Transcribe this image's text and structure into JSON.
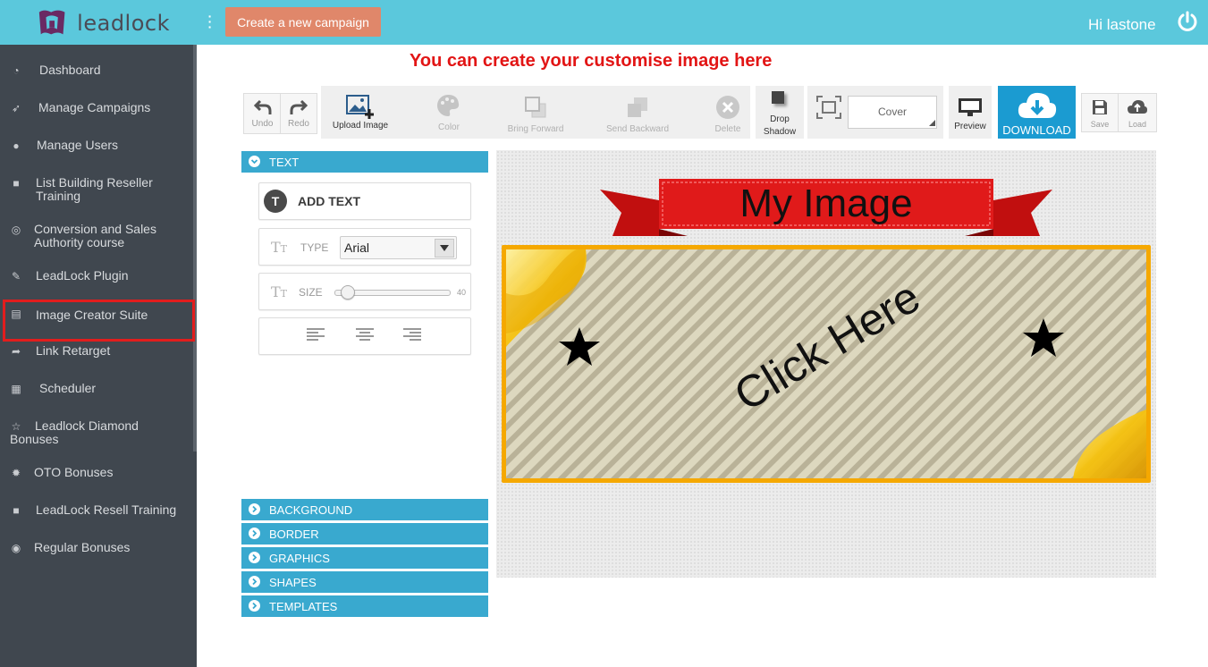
{
  "header": {
    "brand": "leadlock",
    "cta_label": "Create a new campaign",
    "greeting": "Hi lastone"
  },
  "sidebar": {
    "items": [
      {
        "label": "Dashboard",
        "icon": "dashboard-icon"
      },
      {
        "label": "Manage Campaigns",
        "icon": "rocket-icon"
      },
      {
        "label": "Manage Users",
        "icon": "user-icon"
      },
      {
        "label": "List Building Reseller Training",
        "icon": "video-icon"
      },
      {
        "label": "Conversion and Sales Authority course",
        "icon": "target-icon"
      },
      {
        "label": "LeadLock Plugin",
        "icon": "plug-icon"
      },
      {
        "label": "Image Creator Suite",
        "icon": "list-icon",
        "active": true
      },
      {
        "label": "Link Retarget",
        "icon": "share-icon"
      },
      {
        "label": "Scheduler",
        "icon": "calendar-icon"
      },
      {
        "label": "Leadlock Diamond Bonuses",
        "icon": "star-icon"
      },
      {
        "label": "OTO Bonuses",
        "icon": "gear-icon"
      },
      {
        "label": "LeadLock Resell Training",
        "icon": "video-icon"
      },
      {
        "label": "Regular Bonuses",
        "icon": "compass-icon"
      }
    ]
  },
  "main": {
    "headline": "You can create your customise image here"
  },
  "toolbar": {
    "undo": "Undo",
    "redo": "Redo",
    "upload_image": "Upload Image",
    "color": "Color",
    "bring_forward": "Bring Forward",
    "send_backward": "Send Backward",
    "delete": "Delete",
    "drop_shadow_1": "Drop",
    "drop_shadow_2": "Shadow",
    "fit_value": "Cover",
    "preview": "Preview",
    "download": "DOWNLOAD",
    "save": "Save",
    "load": "Load"
  },
  "panel": {
    "text_section": "TEXT",
    "add_text": "ADD TEXT",
    "type_label": "TYPE",
    "font_value": "Arial",
    "size_label": "SIZE",
    "size_value": "40",
    "size_fraction": 0.05,
    "sections": [
      "BACKGROUND",
      "BORDER",
      "GRAPHICS",
      "SHAPES",
      "TEMPLATES"
    ]
  },
  "canvas": {
    "ribbon_text": "My Image",
    "button_text": "Click Here"
  },
  "colors": {
    "topbar": "#5bc8dc",
    "sidebar": "#40474f",
    "accent": "#39a9cf",
    "headline": "#e21515",
    "cta": "#e0876a",
    "ribbon": "#e01a1a",
    "frame": "#f5a800"
  }
}
